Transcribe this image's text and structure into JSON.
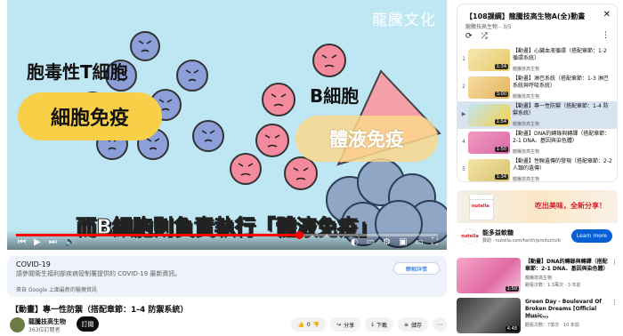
{
  "video": {
    "watermark": "龍騰文化",
    "label_tcell": "胞毒性T細胞",
    "label_cell_immunity": "細胞免疫",
    "label_bcell": "B細胞",
    "label_humoral": "體液免疫",
    "subtitle": "而B細胞則負責執行「體液免疫」",
    "progress": 0.67
  },
  "info_panel": {
    "title": "COVID-19",
    "description": "請參閱衛生福利部疾病管制署提供的 COVID-19 最新資訊。",
    "source": "來自 Google 上面最新的醫療資訊",
    "button_label": "瞭解詳情"
  },
  "video_title": "【動畫】專一性防禦（搭配章節：1-4 防禦系統）",
  "channel": {
    "name": "龍騰技高生物",
    "subscribers": "363位訂閱者",
    "subscribe_label": "訂閱"
  },
  "actions": {
    "like_count": "0",
    "share_label": "分享",
    "download_label": "下載",
    "save_label": "儲存"
  },
  "playlist": {
    "title": "【108課綱】龍騰技高生物A(全)動畫",
    "subtitle": "龍騰技高生物 - 3/5",
    "items": [
      {
        "index": "1",
        "title": "【動畫】心臟血液循環（搭配章節：1-2 循環系統）",
        "channel": "龍騰技高生物",
        "duration": "1:34"
      },
      {
        "index": "2",
        "title": "【動畫】淋巴系統（搭配章節：1-3 淋巴系統與呼吸系統）",
        "channel": "龍騰技高生物",
        "duration": "3:00"
      },
      {
        "index": "▶",
        "title": "【動畫】專一性防禦（搭配章節：1-4 防禦系統）",
        "channel": "龍騰技高生物",
        "duration": "1:54"
      },
      {
        "index": "4",
        "title": "【動畫】DNA的轉錄與轉譯（搭配章節：2-1 DNA、基因與染色體）",
        "channel": "龍騰技高生物",
        "duration": "1:50"
      },
      {
        "index": "5",
        "title": "【動畫】性聯遺傳的發現（搭配章節：2-2 人類的遺傳）",
        "channel": "龍騰技高生物",
        "duration": "1:34"
      }
    ]
  },
  "ad": {
    "jar_brand": "nutella",
    "headline": "吃出美味，全新分享！",
    "advertiser": "能多益軟糖",
    "url": "贊助 · nutella.com/tw/zh/products/b",
    "cta": "Learn more",
    "icon_text": "nutella"
  },
  "recommendations": [
    {
      "title": "【動畫】DNA的轉錄與轉譯（搭配章節：2-1 DNA、基因與染色體）",
      "channel": "龍騰技高生物",
      "meta": "觀看次數：1.3萬次 · 3 年前",
      "duration": "1:50"
    },
    {
      "title": "Green Day - Boulevard Of Broken Dreams [Official Music...",
      "channel": "Green Day",
      "meta": "觀看次數：7億次 · 10 年前",
      "duration": "4:48"
    }
  ],
  "colors": {
    "player_bg": "#bfe7f3",
    "cell_blue": "#8d9fd9",
    "cell_pink": "#f38a9e",
    "highlight_yellow": "#f7d048",
    "progress_red": "#ff0000",
    "link_blue": "#065fd4"
  }
}
